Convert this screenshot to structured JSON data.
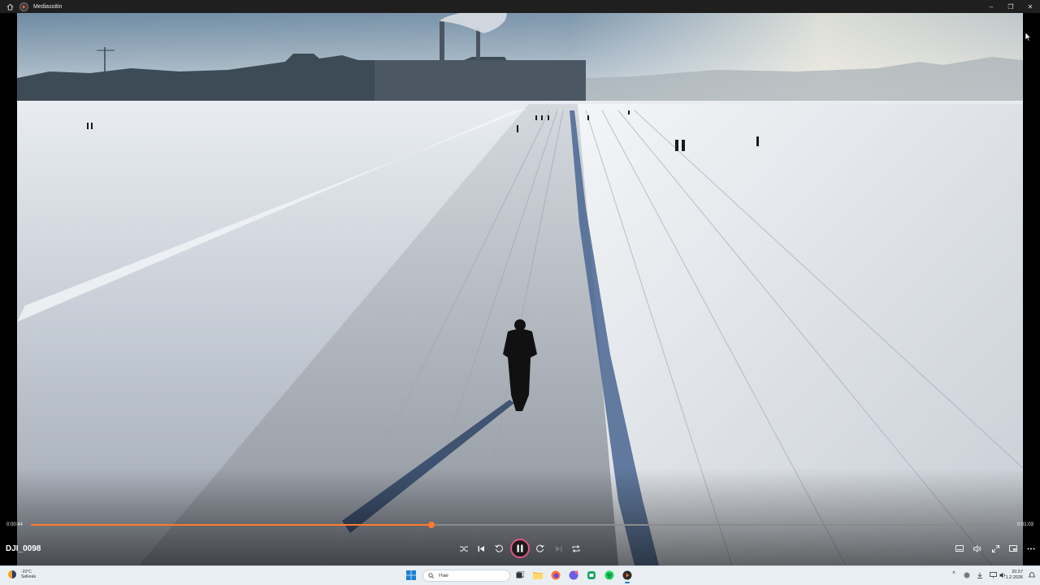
{
  "window": {
    "title": "Mediasoitin"
  },
  "player": {
    "current_time": "0:00:44",
    "total_time": "0:01:03",
    "progress": 0.4096,
    "file_name": "DJI_0098"
  },
  "taskbar": {
    "weather_temp": "-20°C",
    "weather_text": "Selkeää",
    "search_placeholder": "Hae",
    "time": "20.57",
    "date": "1.2.2026"
  },
  "colors": {
    "accent": "#ff7a2b",
    "play_ring": "#e0568a",
    "titlebar": "#1f1f1f",
    "taskbar": "#e9eef3"
  },
  "icons": {
    "shuffle": "shuffle-icon",
    "previous": "previous-icon",
    "rewind": "rewind-10-icon",
    "pause": "pause-icon",
    "forward": "forward-30-icon",
    "next": "next-icon",
    "repeat": "repeat-icon",
    "subtitles": "subtitles-icon",
    "volume": "volume-icon",
    "fullscreen": "fullscreen-icon",
    "miniplayer": "miniplayer-icon",
    "more": "more-icon"
  }
}
